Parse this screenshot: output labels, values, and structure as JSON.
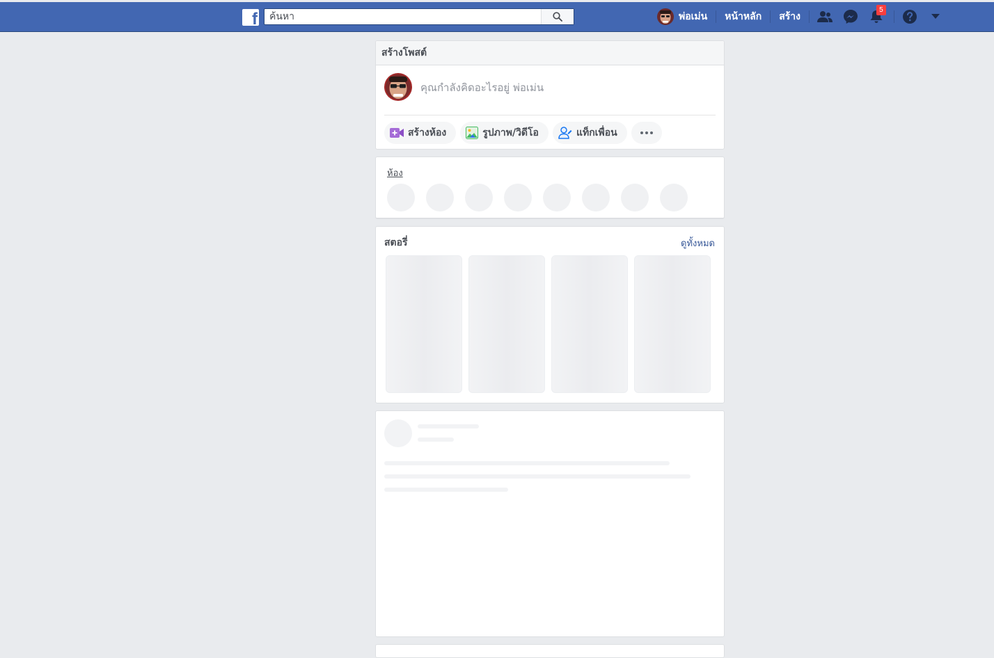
{
  "navbar": {
    "search_placeholder": "ค้นหา",
    "user_name": "พ่อเม่น",
    "home_label": "หน้าหลัก",
    "create_label": "สร้าง",
    "notification_count": "5",
    "icons": [
      "facebook-logo",
      "search-icon",
      "friends-icon",
      "messenger-icon",
      "bell-icon",
      "help-icon",
      "caret-down-icon"
    ]
  },
  "composer": {
    "title": "สร้างโพสต์",
    "placeholder": "คุณกำลังคิดอะไรอยู่ พ่อเม่น",
    "actions": [
      {
        "label": "สร้างห้อง",
        "icon": "video-room-icon"
      },
      {
        "label": "รูปภาพ/วิดีโอ",
        "icon": "photo-icon"
      },
      {
        "label": "แท็กเพื่อน",
        "icon": "tag-friend-icon"
      }
    ],
    "more_icon": "more-icon"
  },
  "rooms": {
    "title": "ห้อง"
  },
  "stories": {
    "title": "สตอรี่",
    "see_all": "ดูทั้งหมด"
  },
  "colors": {
    "navbar": "#4267b2",
    "background": "#e9ebee",
    "link": "#385898",
    "badge": "#fa3e3e"
  }
}
